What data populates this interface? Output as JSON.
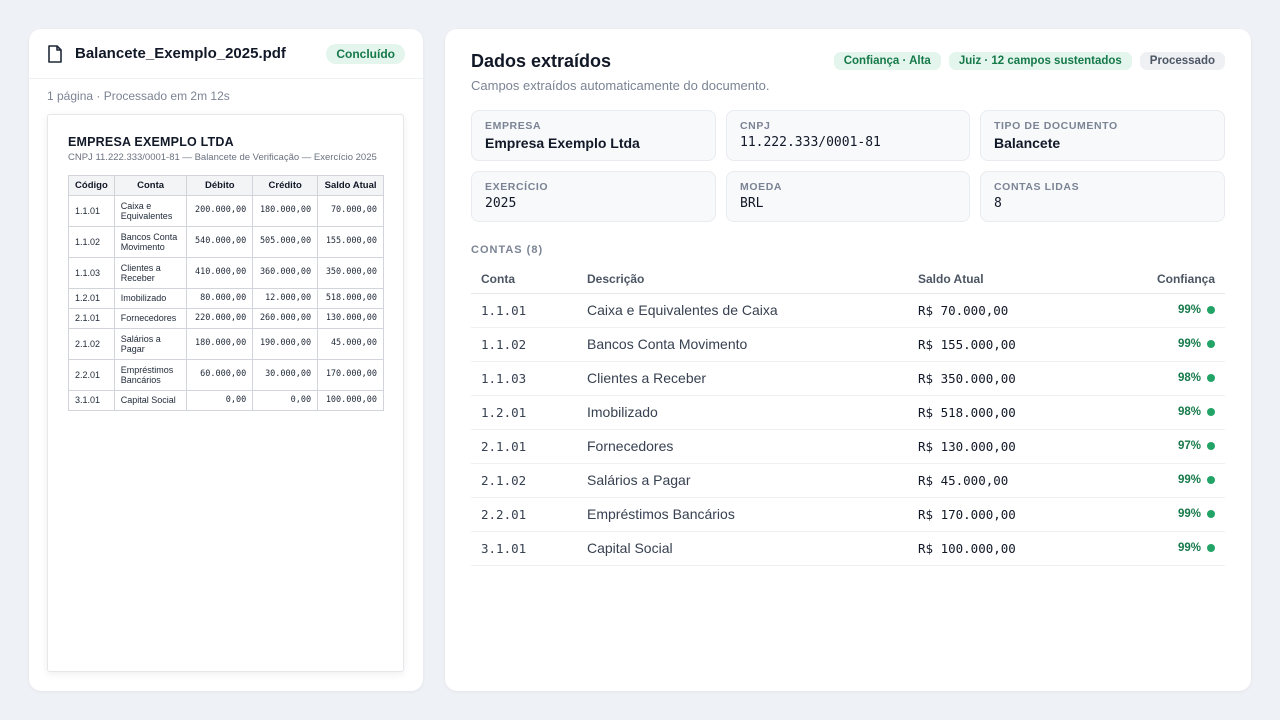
{
  "file": {
    "name": "Balancete_Exemplo_2025.pdf",
    "status": "Concluído",
    "meta": "1 página · Processado em 2m 12s"
  },
  "document": {
    "title": "EMPRESA EXEMPLO LTDA",
    "subtitle": "CNPJ 11.222.333/0001-81 — Balancete de Verificação — Exercício 2025",
    "headers": [
      "Código",
      "Conta",
      "Débito",
      "Crédito",
      "Saldo Atual"
    ],
    "rows": [
      [
        "1.1.01",
        "Caixa e Equivalentes",
        "200.000,00",
        "180.000,00",
        "70.000,00"
      ],
      [
        "1.1.02",
        "Bancos Conta Movimento",
        "540.000,00",
        "505.000,00",
        "155.000,00"
      ],
      [
        "1.1.03",
        "Clientes a Receber",
        "410.000,00",
        "360.000,00",
        "350.000,00"
      ],
      [
        "1.2.01",
        "Imobilizado",
        "80.000,00",
        "12.000,00",
        "518.000,00"
      ],
      [
        "2.1.01",
        "Fornecedores",
        "220.000,00",
        "260.000,00",
        "130.000,00"
      ],
      [
        "2.1.02",
        "Salários a Pagar",
        "180.000,00",
        "190.000,00",
        "45.000,00"
      ],
      [
        "2.2.01",
        "Empréstimos Bancários",
        "60.000,00",
        "30.000,00",
        "170.000,00"
      ],
      [
        "3.1.01",
        "Capital Social",
        "0,00",
        "0,00",
        "100.000,00"
      ]
    ]
  },
  "extracted": {
    "title": "Dados extraídos",
    "subtitle": "Campos extraídos automaticamente do documento.",
    "pills": [
      {
        "label": "Confiança · Alta",
        "tone": "green"
      },
      {
        "label": "Juiz · 12 campos sustentados",
        "tone": "green"
      },
      {
        "label": "Processado",
        "tone": "gray"
      }
    ],
    "fields": [
      {
        "label": "EMPRESA",
        "value": "Empresa Exemplo Ltda",
        "mono": false
      },
      {
        "label": "CNPJ",
        "value": "11.222.333/0001-81",
        "mono": true
      },
      {
        "label": "TIPO DE DOCUMENTO",
        "value": "Balancete",
        "mono": false
      },
      {
        "label": "EXERCÍCIO",
        "value": "2025",
        "mono": true
      },
      {
        "label": "MOEDA",
        "value": "BRL",
        "mono": true
      },
      {
        "label": "CONTAS LIDAS",
        "value": "8",
        "mono": true
      }
    ],
    "accounts_title": "CONTAS (8)",
    "accounts_headers": [
      "Conta",
      "Descrição",
      "Saldo Atual",
      "Confiança"
    ],
    "accounts": [
      {
        "code": "1.1.01",
        "desc": "Caixa e Equivalentes de Caixa",
        "balance": "R$ 70.000,00",
        "conf": "99%"
      },
      {
        "code": "1.1.02",
        "desc": "Bancos Conta Movimento",
        "balance": "R$ 155.000,00",
        "conf": "99%"
      },
      {
        "code": "1.1.03",
        "desc": "Clientes a Receber",
        "balance": "R$ 350.000,00",
        "conf": "98%"
      },
      {
        "code": "1.2.01",
        "desc": "Imobilizado",
        "balance": "R$ 518.000,00",
        "conf": "98%"
      },
      {
        "code": "2.1.01",
        "desc": "Fornecedores",
        "balance": "R$ 130.000,00",
        "conf": "97%"
      },
      {
        "code": "2.1.02",
        "desc": "Salários a Pagar",
        "balance": "R$ 45.000,00",
        "conf": "99%"
      },
      {
        "code": "2.2.01",
        "desc": "Empréstimos Bancários",
        "balance": "R$ 170.000,00",
        "conf": "99%"
      },
      {
        "code": "3.1.01",
        "desc": "Capital Social",
        "balance": "R$ 100.000,00",
        "conf": "99%"
      }
    ]
  },
  "colors": {
    "accent_green": "#16794a",
    "dot_green": "#22a466",
    "badge_green_bg": "#e3f5ec",
    "page_bg": "#eef1f5"
  },
  "icons": {
    "file": "file-icon",
    "status_dot": "status-dot-icon"
  }
}
